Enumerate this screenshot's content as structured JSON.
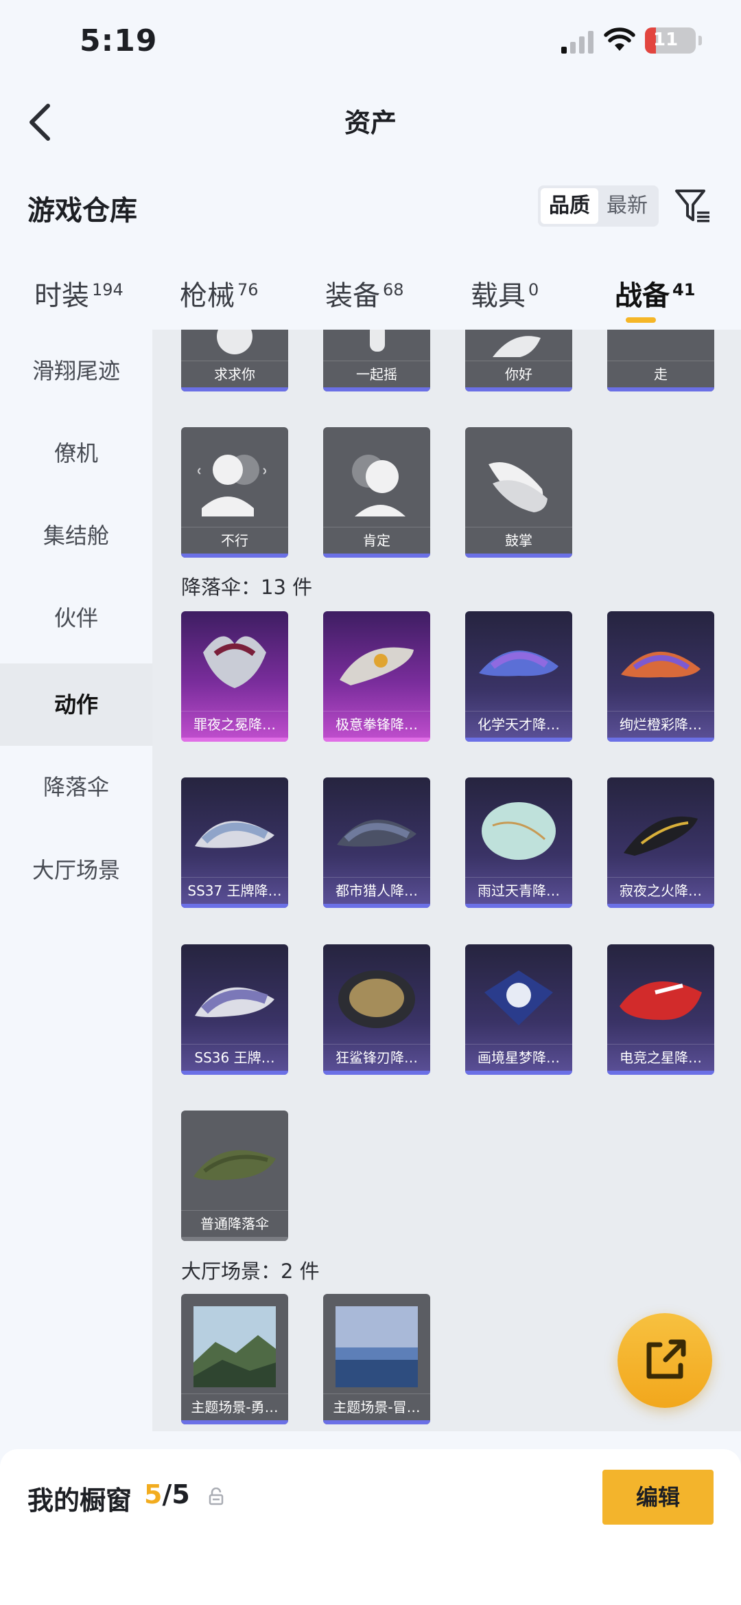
{
  "status_bar": {
    "time": "5:19",
    "battery": "11"
  },
  "header": {
    "title": "资产"
  },
  "warehouse": {
    "title": "游戏仓库",
    "sort": {
      "quality": "品质",
      "newest": "最新"
    }
  },
  "tabs": [
    {
      "label": "时装",
      "count": "194"
    },
    {
      "label": "枪械",
      "count": "76"
    },
    {
      "label": "装备",
      "count": "68"
    },
    {
      "label": "载具",
      "count": "0"
    },
    {
      "label": "战备",
      "count": "41"
    }
  ],
  "sidebar": [
    {
      "label": "滑翔尾迹"
    },
    {
      "label": "僚机"
    },
    {
      "label": "集结舱"
    },
    {
      "label": "伙伴"
    },
    {
      "label": "动作"
    },
    {
      "label": "降落伞"
    },
    {
      "label": "大厅场景"
    }
  ],
  "emotes_row1": [
    "求求你",
    "一起摇",
    "你好",
    "走"
  ],
  "emotes_row2": [
    "不行",
    "肯定",
    "鼓掌"
  ],
  "parachute_section": "降落伞：13 件",
  "parachutes": [
    "罪夜之冕降…",
    "极意拳锋降…",
    "化学天才降…",
    "绚烂橙彩降…",
    "SS37 王牌降…",
    "都市猎人降…",
    "雨过天青降…",
    "寂夜之火降…",
    "SS36 王牌…",
    "狂鲨锋刃降…",
    "画境星梦降…",
    "电竞之星降…",
    "普通降落伞"
  ],
  "lobby_section": "大厅场景：2 件",
  "lobby_scenes": [
    "主题场景-勇…",
    "主题场景-冒…"
  ],
  "showcase": {
    "label": "我的橱窗",
    "current": "5",
    "total": "/5"
  },
  "edit_button": "编辑"
}
